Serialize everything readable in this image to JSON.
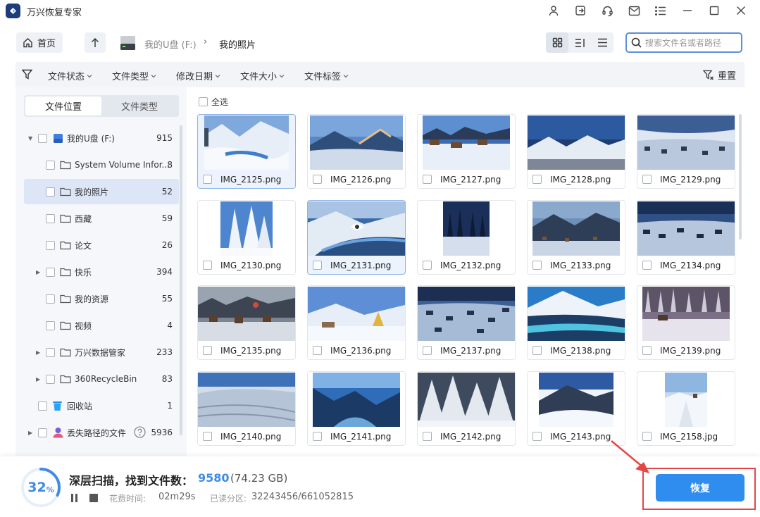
{
  "app": {
    "title": "万兴恢复专家"
  },
  "nav": {
    "home_label": "首页",
    "drive_label": "我的U盘 (F:)",
    "separator": "›",
    "current_folder": "我的照片",
    "search_placeholder": "搜索文件名或者路径"
  },
  "filters": {
    "items": [
      "文件状态",
      "文件类型",
      "修改日期",
      "文件大小",
      "文件标签"
    ],
    "reset_label": "重置"
  },
  "sidebar": {
    "tabs": [
      "文件位置",
      "文件类型"
    ],
    "tree": [
      {
        "label": "我的U盘 (F:)",
        "count": "915",
        "icon": "usb-drive-icon"
      },
      {
        "label": "System Volume Infor...",
        "count": "8",
        "icon": "folder-icon"
      },
      {
        "label": "我的照片",
        "count": "52",
        "icon": "folder-icon"
      },
      {
        "label": "西藏",
        "count": "59",
        "icon": "folder-icon"
      },
      {
        "label": "论文",
        "count": "26",
        "icon": "folder-icon"
      },
      {
        "label": "快乐",
        "count": "394",
        "icon": "folder-icon"
      },
      {
        "label": "我的资源",
        "count": "55",
        "icon": "folder-icon"
      },
      {
        "label": "视频",
        "count": "4",
        "icon": "folder-icon"
      },
      {
        "label": "万兴数据管家",
        "count": "233",
        "icon": "folder-icon"
      },
      {
        "label": "360RecycleBin",
        "count": "83",
        "icon": "folder-icon"
      },
      {
        "label": "回收站",
        "count": "1",
        "icon": "recycle-bin-icon"
      },
      {
        "label": "丢失路径的文件",
        "count": "5936",
        "icon": "lost-files-icon"
      }
    ]
  },
  "grid": {
    "select_all_label": "全选",
    "files": [
      "IMG_2125.png",
      "IMG_2126.png",
      "IMG_2127.png",
      "IMG_2128.png",
      "IMG_2129.png",
      "IMG_2130.png",
      "IMG_2131.png",
      "IMG_2132.png",
      "IMG_2133.png",
      "IMG_2134.png",
      "IMG_2135.png",
      "IMG_2136.png",
      "IMG_2137.png",
      "IMG_2138.png",
      "IMG_2139.png",
      "IMG_2140.png",
      "IMG_2141.png",
      "IMG_2142.png",
      "IMG_2143.png",
      "IMG_2158.jpg"
    ]
  },
  "scan": {
    "progress_value": "32",
    "progress_unit": "%",
    "progress_fraction": 0.32,
    "title": "深层扫描，找到文件数：",
    "count": "9580",
    "size": "(74.23 GB)",
    "time_label": "花费时间:",
    "time_value": "02m29s",
    "sectors_label": "已读分区:",
    "sectors_value": "32243456/661052815"
  },
  "actions": {
    "recover_label": "恢复"
  },
  "colors": {
    "accent": "#2f8df0",
    "highlight": "#e64545"
  }
}
